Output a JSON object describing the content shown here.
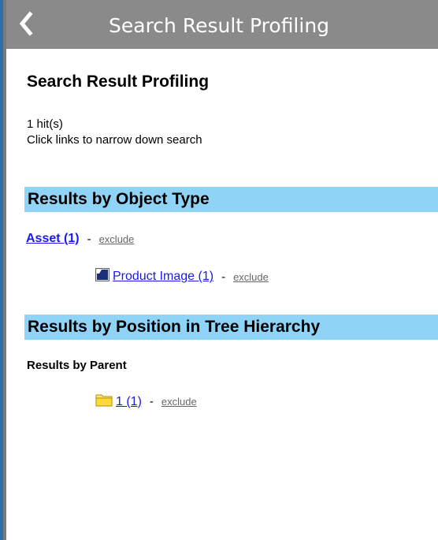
{
  "header": {
    "title": "Search Result Profiling",
    "back_icon": "chevron-left-icon"
  },
  "main": {
    "title": "Search Result Profiling",
    "hits": "1 hit(s)",
    "hint": "Click links to narrow down search"
  },
  "object_type": {
    "heading": "Results by Object Type",
    "asset": {
      "label": "Asset (1)",
      "exclude": "exclude"
    },
    "product_image": {
      "label": "Product Image (1)",
      "exclude": "exclude",
      "icon": "image-type-icon"
    }
  },
  "tree_hierarchy": {
    "heading": "Results by Position in Tree Hierarchy",
    "subheading": "Results by Parent",
    "parent": {
      "label": "1 (1)",
      "exclude": "exclude",
      "icon": "folder-icon"
    }
  },
  "colors": {
    "header_bg": "#8a8a8a",
    "section_bg": "#8fd3f7",
    "link": "#1a1aee",
    "exclude": "#666666",
    "accent_border": "#2e6ea6"
  },
  "separator": "-"
}
